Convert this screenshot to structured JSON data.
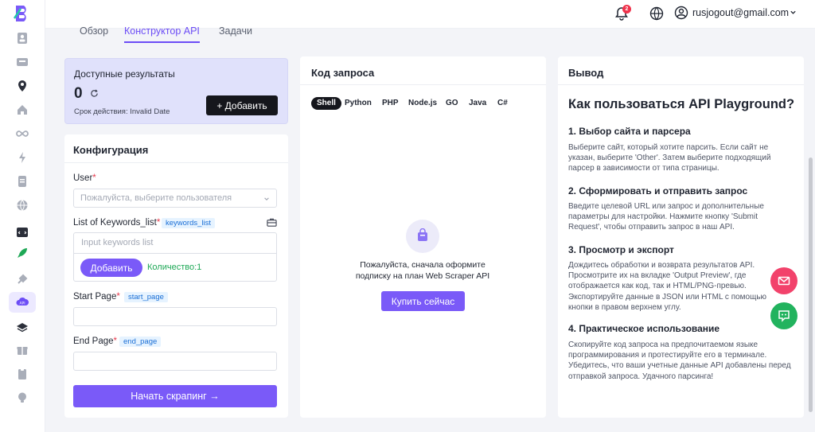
{
  "header": {
    "tabs": [
      {
        "label": "Обзор",
        "active": false
      },
      {
        "label": "Конструктор API",
        "active": true
      },
      {
        "label": "Задачи",
        "active": false
      }
    ],
    "notifications_count": "2",
    "user_email": "rusjogout@gmail.com"
  },
  "results": {
    "title": "Доступные результаты",
    "count": "0",
    "expiry": "Срок действия: Invalid Date",
    "add_button": "+ Добавить"
  },
  "config": {
    "title": "Конфигурация",
    "user_label": "User",
    "user_placeholder": "Пожалуйста, выберите пользователя",
    "keywords_label": "List of Keywords_list",
    "keywords_tag": "keywords_list",
    "keywords_placeholder": "Input keywords list",
    "keywords_add_button": "Добавить",
    "keywords_quantity": "Количество:1",
    "start_page_label": "Start Page",
    "start_page_tag": "start_page",
    "end_page_label": "End Page",
    "end_page_tag": "end_page",
    "start_button": "Начать скрапинг →"
  },
  "code": {
    "title": "Код запроса",
    "languages": [
      "Shell",
      "Python",
      "PHP",
      "Node.js",
      "GO",
      "Java",
      "C#"
    ],
    "active_language": "Shell",
    "empty_line1": "Пожалуйста, сначала оформите",
    "empty_line2": "подписку на план Web Scraper API",
    "buy_button": "Купить сейчас"
  },
  "output": {
    "title": "Вывод",
    "heading": "Как пользоваться API Playground?",
    "sections": [
      {
        "title": "1. Выбор сайта и парсера",
        "text": "Выберите сайт, который хотите парсить. Если сайт не указан, выберите 'Other'. Затем выберите подходящий парсер в зависимости от типа страницы."
      },
      {
        "title": "2. Сформировать и отправить запрос",
        "text": "Введите целевой URL или запрос и дополнительные параметры для настройки. Нажмите кнопку 'Submit Request', чтобы отправить запрос в наш API."
      },
      {
        "title": "3. Просмотр и экспорт",
        "text": "Дождитесь обработки и возврата результатов API. Просмотрите их на вкладке 'Output Preview', где отображается как код, так и HTML/PNG-превью. Экспортируйте данные в JSON или HTML с помощью кнопки в правом верхнем углу."
      },
      {
        "title": "4. Практическое использование",
        "text": "Скопируйте код запроса на предпочитаемом языке программирования и протестируйте его в терминале. Убедитесь, что ваши учетные данные API добавлены перед отправкой запроса. Удачного парсинга!"
      }
    ]
  },
  "colors": {
    "accent": "#7a5af8",
    "dark": "#15161c",
    "success": "#1ea856",
    "danger": "#f2426b"
  }
}
